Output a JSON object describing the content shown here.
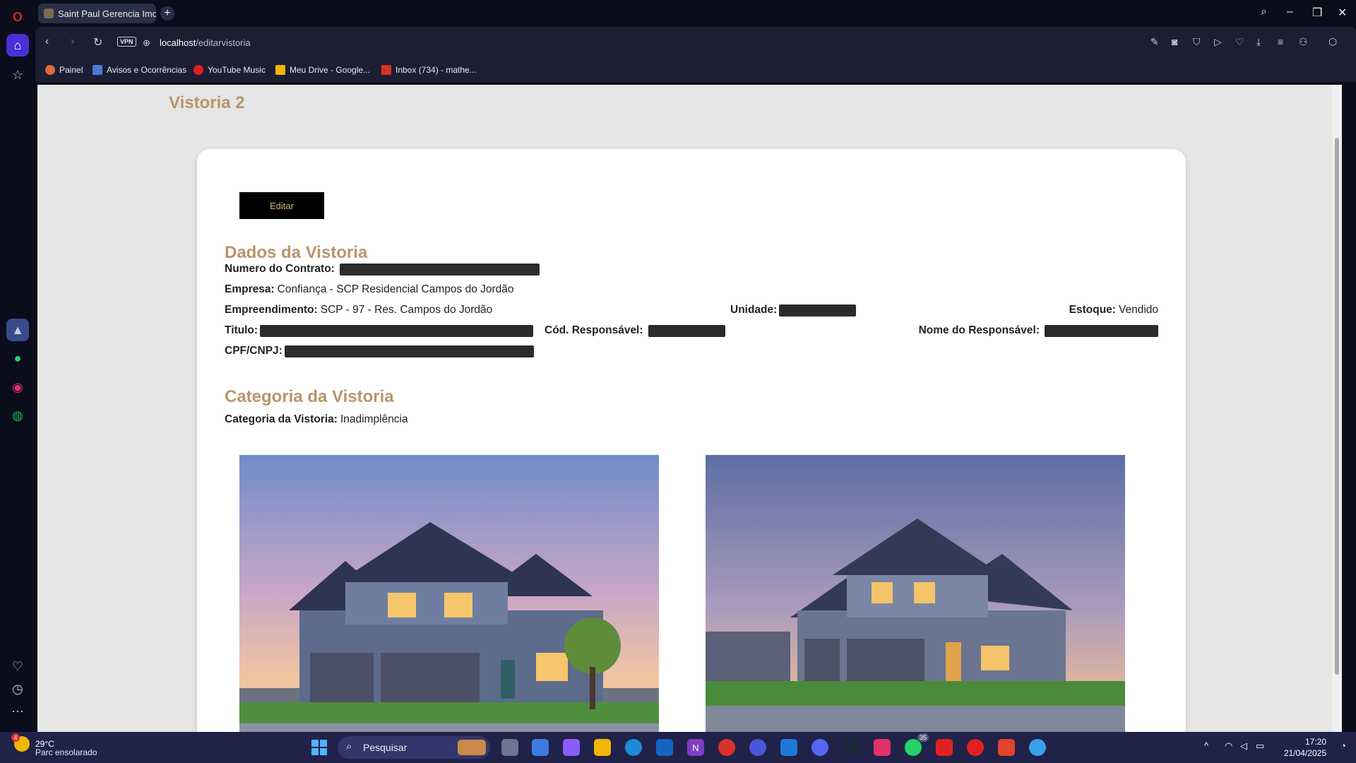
{
  "browser": {
    "tab_title": "Saint Paul Gerencia Imobi",
    "url_host": "localhost",
    "url_path": "/editarvistoria",
    "vpn_label": "VPN",
    "bookmarks": [
      {
        "label": "Painel",
        "color": "#e26a3a"
      },
      {
        "label": "Avisos e Ocorrências",
        "color": "#4a7bd0"
      },
      {
        "label": "YouTube Music",
        "color": "#e02020"
      },
      {
        "label": "Meu Drive - Google...",
        "color": "#f2b705"
      },
      {
        "label": "Inbox (734) - mathe...",
        "color": "#d93025"
      }
    ]
  },
  "page": {
    "title": "Vistoria 2",
    "edit_button": "Editar",
    "dados_heading": "Dados da Vistoria",
    "fields": {
      "numero_contrato_label": "Numero do Contrato:",
      "empresa_label": "Empresa:",
      "empresa_value": "Confiança - SCP Residencial Campos do Jordão",
      "empreendimento_label": "Empreendimento:",
      "empreendimento_value": "SCP - 97 - Res. Campos do Jordão",
      "unidade_label": "Unidade:",
      "estoque_label": "Estoque:",
      "estoque_value": "Vendido",
      "titulo_label": "Titulo:",
      "cod_responsavel_label": "Cód. Responsável:",
      "nome_responsavel_label": "Nome do Responsável:",
      "cpf_label": "CPF/CNPJ:"
    },
    "categoria_heading": "Categoria da Vistoria",
    "categoria_label": "Categoria da Vistoria:",
    "categoria_value": "Inadimplência"
  },
  "taskbar": {
    "temperature": "29°C",
    "weather_desc": "Parc ensolarado",
    "search_placeholder": "Pesquisar",
    "time": "17:20",
    "date": "21/04/2025",
    "weather_badge": "4",
    "whatsapp_badge": "35"
  },
  "colors": {
    "accent_gold": "#b8956a",
    "button_bg": "#000000",
    "page_bg": "#e6e6e6"
  }
}
